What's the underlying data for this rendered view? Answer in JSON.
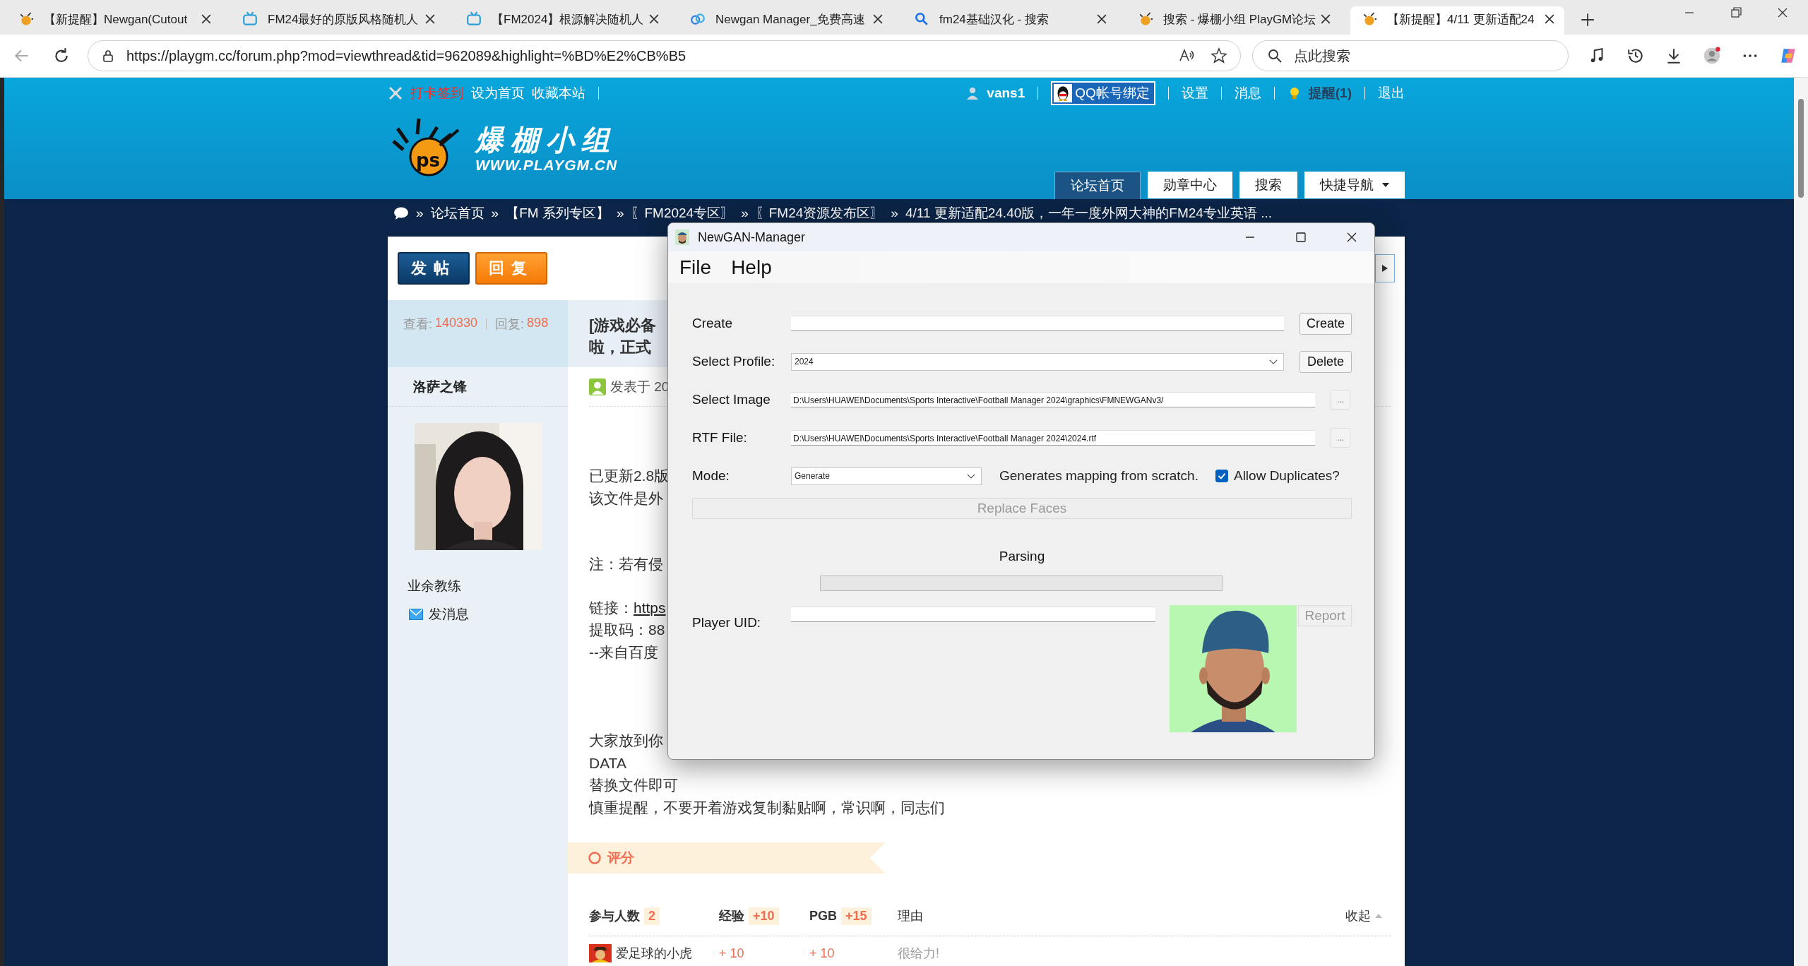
{
  "browser": {
    "tabs": [
      {
        "title": "【新提醒】Newgan(Cutout",
        "selected": false
      },
      {
        "title": "FM24最好的原版风格随机人",
        "selected": false
      },
      {
        "title": "【FM2024】根源解决随机人",
        "selected": false
      },
      {
        "title": "Newgan Manager_免费高速",
        "selected": false
      },
      {
        "title": "fm24基础汉化 - 搜索",
        "selected": false
      },
      {
        "title": "搜索 - 爆棚小组 PlayGM论坛",
        "selected": false
      },
      {
        "title": "【新提醒】4/11 更新适配24",
        "selected": true
      }
    ],
    "address": "https://playgm.cc/forum.php?mod=viewthread&tid=962089&highlight=%BD%E2%CB%B5",
    "search": {
      "placeholder": "点此搜索"
    }
  },
  "forum": {
    "top_links_left": [
      {
        "label": "打卡签到",
        "kind": "highlight"
      },
      {
        "label": "设为首页",
        "kind": "link"
      },
      {
        "label": "收藏本站",
        "kind": "link"
      }
    ],
    "user": "vans1",
    "qq_button": "QQ帐号绑定",
    "top_links_right": [
      "设置",
      "消息"
    ],
    "reminder": "提醒(1)",
    "logout": "退出",
    "logo": {
      "badge": "ps",
      "title": "爆棚小组",
      "url": "WWW.PLAYGM.CN"
    },
    "nav": [
      {
        "label": "论坛首页",
        "kind": "link",
        "selected": true
      },
      {
        "label": "勋章中心",
        "kind": "link",
        "selected": false
      },
      {
        "label": "搜索",
        "kind": "link",
        "selected": false
      },
      {
        "label": "快捷导航",
        "kind": "menu",
        "selected": false
      }
    ],
    "breadcrumb": {
      "separator": "»",
      "items": [
        "论坛首页",
        "【FM 系列专区】",
        "〖FM2024专区〗",
        "〖FM24资源发布区〗",
        "4/11 更新适配24.40版，一年一度外网大神的FM24专业英语 ..."
      ]
    },
    "actions": [
      {
        "label": "发帖",
        "kind": "post"
      },
      {
        "label": "回复",
        "kind": "reply"
      }
    ],
    "stats": {
      "views_label": "查看:",
      "views": "140330",
      "replies_label": "回复:",
      "replies": "898"
    },
    "author": {
      "name": "洛萨之锋",
      "rank": "业余教练",
      "message": "发消息",
      "avatar": {
        "kind": "picture"
      }
    },
    "post": {
      "title_lines": [
        "[游戏必备",
        "啦，正式"
      ],
      "posted": "发表于 20",
      "paragraphs": [
        [
          {
            "kind": "text",
            "text": "已更新2.8版"
          },
          {
            "kind": "text",
            "text": "该文件是外"
          }
        ],
        [
          {
            "kind": "text",
            "text": "注：若有侵"
          }
        ],
        [
          {
            "kind": "link",
            "text": "链接：",
            "link": "https"
          },
          {
            "kind": "text",
            "text": "提取码：88"
          },
          {
            "kind": "text",
            "text": "--来自百度"
          }
        ],
        [
          {
            "kind": "text",
            "text": "大家放到你"
          },
          {
            "kind": "text",
            "text": "DATA"
          },
          {
            "kind": "text",
            "text": "替换文件即可"
          },
          {
            "kind": "text",
            "text": "慎重提醒，不要开着游戏复制黏贴啊，常识啊，同志们"
          }
        ]
      ]
    },
    "rating": {
      "title": "评分",
      "columns": [
        {
          "label": "参与人数",
          "badge": "2"
        },
        {
          "label": "经验",
          "badge": "+10"
        },
        {
          "label": "PGB",
          "badge": "+15"
        },
        {
          "label": "理由"
        }
      ],
      "collapse": "收起",
      "rows": [
        {
          "user": "爱足球的小虎",
          "exp": "+ 10",
          "pgb": "+ 10",
          "reason": "很给力!"
        }
      ]
    }
  },
  "dialog": {
    "title": "NewGAN-Manager",
    "menu": [
      "File",
      "Help"
    ],
    "rows": [
      {
        "kind": "field",
        "label": "Create",
        "button": "Create"
      },
      {
        "kind": "combo",
        "label": "Select Profile:",
        "value": "2024",
        "button": "Delete"
      },
      {
        "kind": "path",
        "label": "Select Image",
        "value": "D:\\Users\\HUAWEI\\Documents\\Sports Interactive\\Football Manager 2024\\graphics\\FMNEWGANv3/",
        "button": "..."
      },
      {
        "kind": "path",
        "label": "RTF File:",
        "value": "D:\\Users\\HUAWEI\\Documents\\Sports Interactive\\Football Manager 2024\\2024.rtf",
        "button": "..."
      },
      {
        "kind": "mode",
        "label": "Mode:",
        "value": "Generate",
        "hint": "Generates mapping from scratch.",
        "checkbox": {
          "label": "Allow Duplicates?",
          "checked": true
        }
      }
    ],
    "replace_button": {
      "label": "Replace Faces",
      "disabled": true
    },
    "status": "Parsing",
    "progress": {
      "level": 0
    },
    "player_uid": {
      "label": "Player UID:"
    },
    "report_button": {
      "label": "Report",
      "disabled": true
    },
    "portrait": {
      "kind": "picture"
    }
  }
}
